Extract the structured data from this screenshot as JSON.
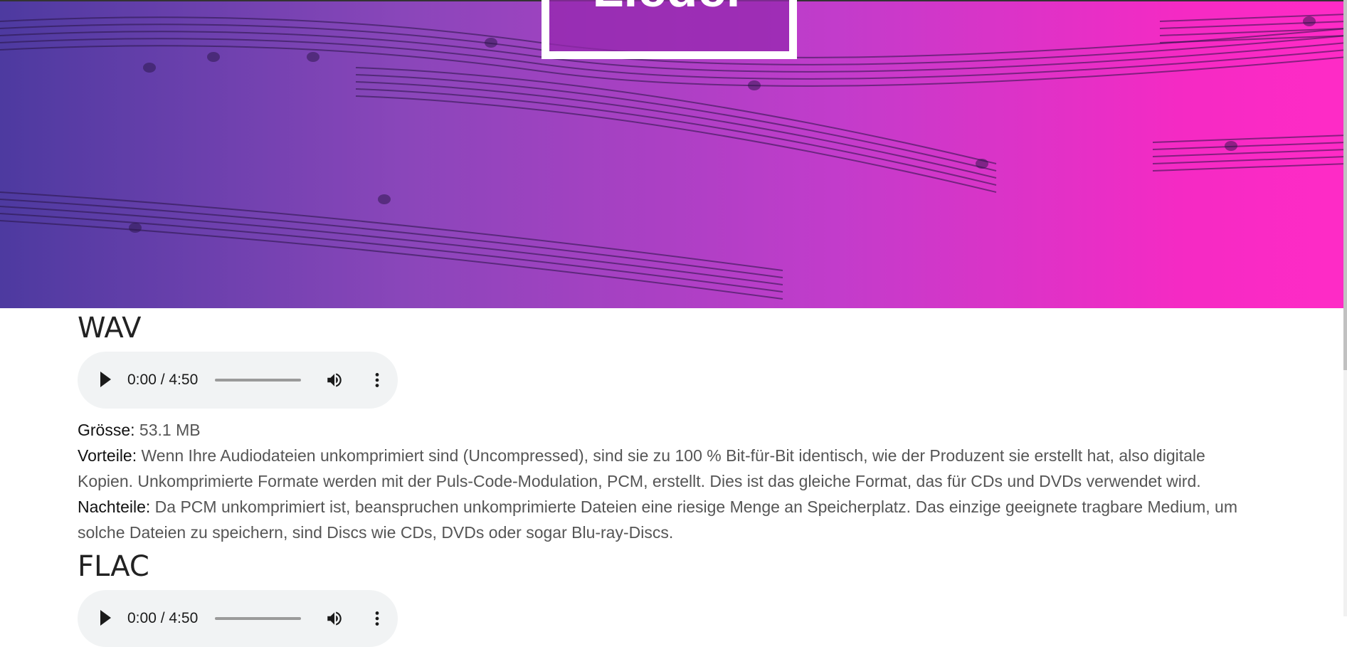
{
  "hero": {
    "title": "Lieder"
  },
  "sections": [
    {
      "title": "WAV",
      "player": {
        "time": "0:00 / 4:50",
        "progress": 0
      },
      "size_label": "Grösse:",
      "size_value": " 53.1 MB",
      "pros_label": "Vorteile:",
      "pros_text": " Wenn Ihre Audiodateien unkomprimiert sind (Uncompressed), sind sie zu 100 % Bit-für-Bit identisch, wie der Produzent sie erstellt hat, also digitale Kopien. Unkomprimierte Formate werden mit der Puls-Code-Modulation, PCM, erstellt. Dies ist das gleiche Format, das für CDs und DVDs verwendet wird.",
      "cons_label": "Nachteile:",
      "cons_text": " Da PCM unkomprimiert ist, beanspruchen unkomprimierte Dateien eine riesige Menge an Speicherplatz. Das einzige geeignete tragbare Medium, um solche Dateien zu speichern, sind Discs wie CDs, DVDs oder sogar Blu-ray-Discs."
    },
    {
      "title": "FLAC",
      "player": {
        "time": "0:00 / 4:50",
        "progress": 0
      }
    }
  ],
  "icons": {
    "play": "play-icon",
    "volume": "volume-icon",
    "more": "more-vert-icon"
  },
  "colors": {
    "hero_gradient_start": "#4d3aa0",
    "hero_gradient_end": "#ff2bc6",
    "player_bg": "#f1f3f4"
  }
}
